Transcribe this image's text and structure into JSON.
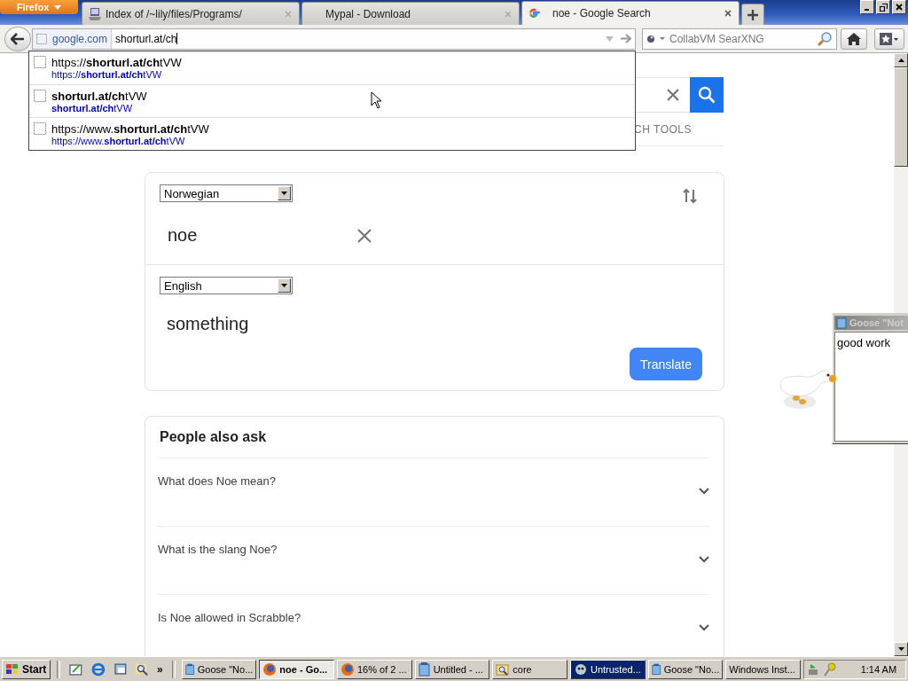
{
  "browser": {
    "menu_button": "Firefox",
    "tabs": [
      {
        "title": "Index of /~lily/files/Programs/",
        "kind": "server",
        "selected": false
      },
      {
        "title": "Mypal - Download",
        "kind": "blank",
        "selected": false
      },
      {
        "title": "noe - Google Search",
        "kind": "google",
        "selected": true
      }
    ],
    "site_identity": "google.com",
    "url": "shorturl.at/ch",
    "search_placeholder": "CollabVM SearXNG",
    "suggestions": [
      {
        "title": "https://**shorturl.at/ch**tVW",
        "url": "https://**shorturl.at/ch**tVW",
        "selected": false
      },
      {
        "title": "**shorturl.at/ch**tVW",
        "url": "**shorturl.at/ch**tVW",
        "selected": false
      },
      {
        "title": "https://www.**shorturl.at/ch**tVW",
        "url": "https://www.**shorturl.at/ch**tVW",
        "selected": false
      }
    ]
  },
  "page": {
    "tools_label": "CH TOOLS",
    "translate": {
      "source_language": "Norwegian",
      "source_text": "noe",
      "target_language": "English",
      "translation": "something",
      "button": "Translate"
    },
    "people_also_ask": {
      "title": "People also ask",
      "questions": [
        {
          "text": "What does Noe mean?",
          "expanded": false
        },
        {
          "text": "What is the slang Noe?",
          "expanded": false
        },
        {
          "text": "Is Noe allowed in Scrabble?",
          "expanded": false
        }
      ]
    }
  },
  "goose_window": {
    "title": "Goose \"Not",
    "text": "good work"
  },
  "taskbar": {
    "start": "Start",
    "more": "»",
    "items": [
      {
        "label": "Goose \"No...",
        "kind": "note",
        "selected": false,
        "flashing": false
      },
      {
        "label": "noe - Go...",
        "kind": "firefox",
        "selected": true,
        "flashing": false
      },
      {
        "label": "16% of 2 ...",
        "kind": "firefox",
        "selected": false,
        "flashing": false
      },
      {
        "label": "Untitled - ...",
        "kind": "note",
        "selected": false,
        "flashing": false
      },
      {
        "label": "core",
        "kind": "folder",
        "selected": false,
        "flashing": false
      },
      {
        "label": "Untrusted...",
        "kind": "app",
        "selected": false,
        "flashing": true
      },
      {
        "label": "Goose \"No...",
        "kind": "note",
        "selected": false,
        "flashing": false
      },
      {
        "label": "Windows Inst...",
        "kind": "blank",
        "selected": false,
        "flashing": false
      }
    ],
    "clock": "1:14 AM"
  }
}
